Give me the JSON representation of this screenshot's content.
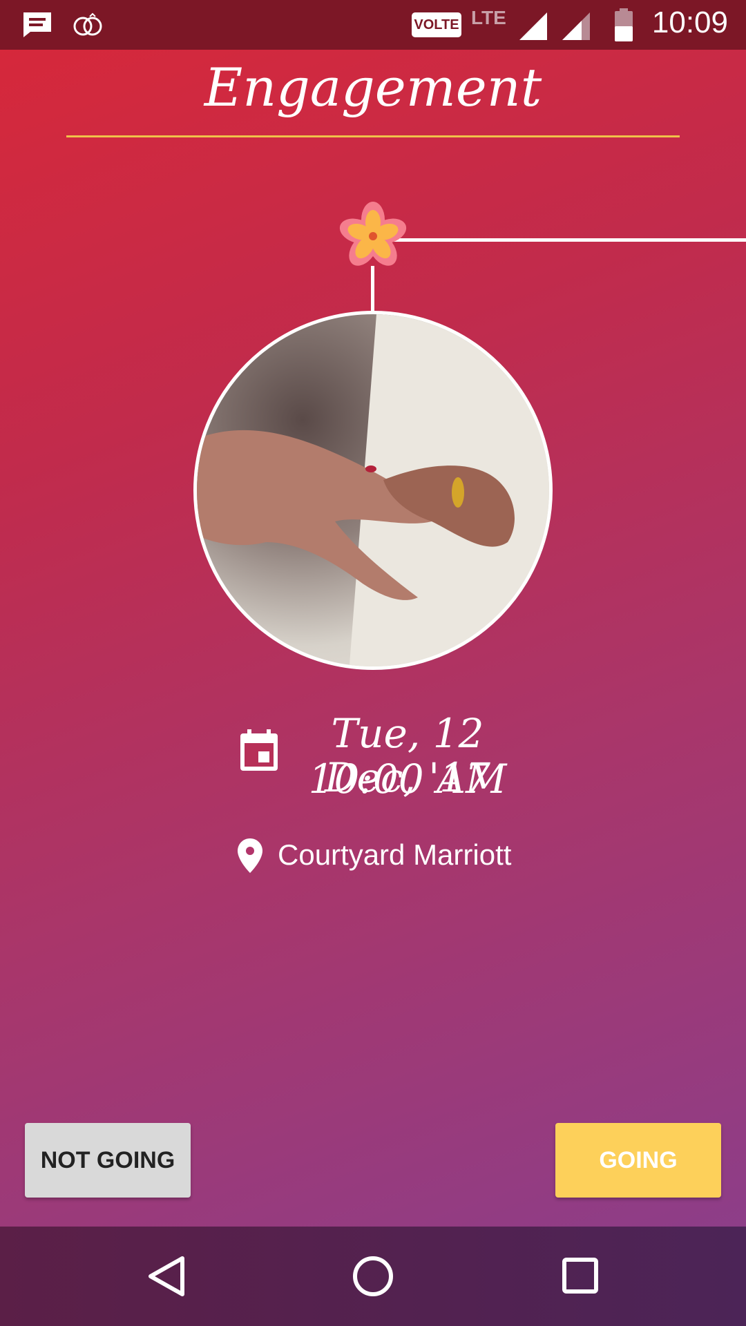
{
  "status_bar": {
    "time": "10:09",
    "volte_label": "VOLTE",
    "network_label": "LTE",
    "icons": [
      "message-icon",
      "rings-icon",
      "signal-icon",
      "signal-icon",
      "battery-icon"
    ]
  },
  "event": {
    "title": "Engagement",
    "date": "Tue, 12 Dec, '17",
    "time": "10:00 AM",
    "venue": "Courtyard Marriott"
  },
  "actions": {
    "not_going_label": "NOT GOING",
    "going_label": "GOING"
  },
  "nav_bar": {
    "icons": [
      "back-icon",
      "home-icon",
      "recents-icon"
    ]
  },
  "colors": {
    "accent_yellow": "#fdd05a",
    "status_bar": "#7c1726",
    "gradient_top": "#d82839",
    "gradient_bottom": "#883f8e"
  }
}
